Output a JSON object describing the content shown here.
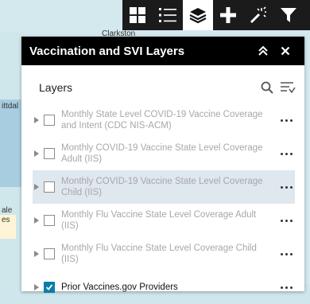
{
  "map": {
    "labels": [
      "Clarkston",
      "ittdal",
      "ale",
      "es"
    ]
  },
  "toolbar": {
    "tools": [
      {
        "icon": "basemap-gallery-icon",
        "active": false
      },
      {
        "icon": "legend-icon",
        "active": false
      },
      {
        "icon": "layers-icon",
        "active": true
      },
      {
        "icon": "add-data-icon",
        "active": false
      },
      {
        "icon": "magic-wand-icon",
        "active": false
      },
      {
        "icon": "filter-icon",
        "active": false
      }
    ]
  },
  "panel": {
    "title": "Vaccination and SVI Layers",
    "section_title": "Layers",
    "layers": [
      {
        "label": "Monthly State Level COVID-19 Vaccine Coverage and Intent (CDC NIS-ACM)",
        "checked": false,
        "highlighted": false
      },
      {
        "label": "Monthly COVID-19 Vaccine State Level Coverage Adult (IIS)",
        "checked": false,
        "highlighted": false
      },
      {
        "label": "Monthly COVID-19 Vaccine State Level Coverage Child (IIS)",
        "checked": false,
        "highlighted": true
      },
      {
        "label": "Monthly Flu Vaccine State Level Coverage Adult (IIS)",
        "checked": false,
        "highlighted": false
      },
      {
        "label": "Monthly Flu Vaccine State Level Coverage Child (IIS)",
        "checked": false,
        "highlighted": false
      },
      {
        "label": "Prior Vaccines.gov Providers",
        "checked": true,
        "highlighted": false
      }
    ]
  },
  "colors": {
    "toolbar_bg": "#1b1b1b",
    "header_bg": "#000000",
    "checked": "#0a7ea8",
    "highlight_row": "#dfe7ef"
  }
}
